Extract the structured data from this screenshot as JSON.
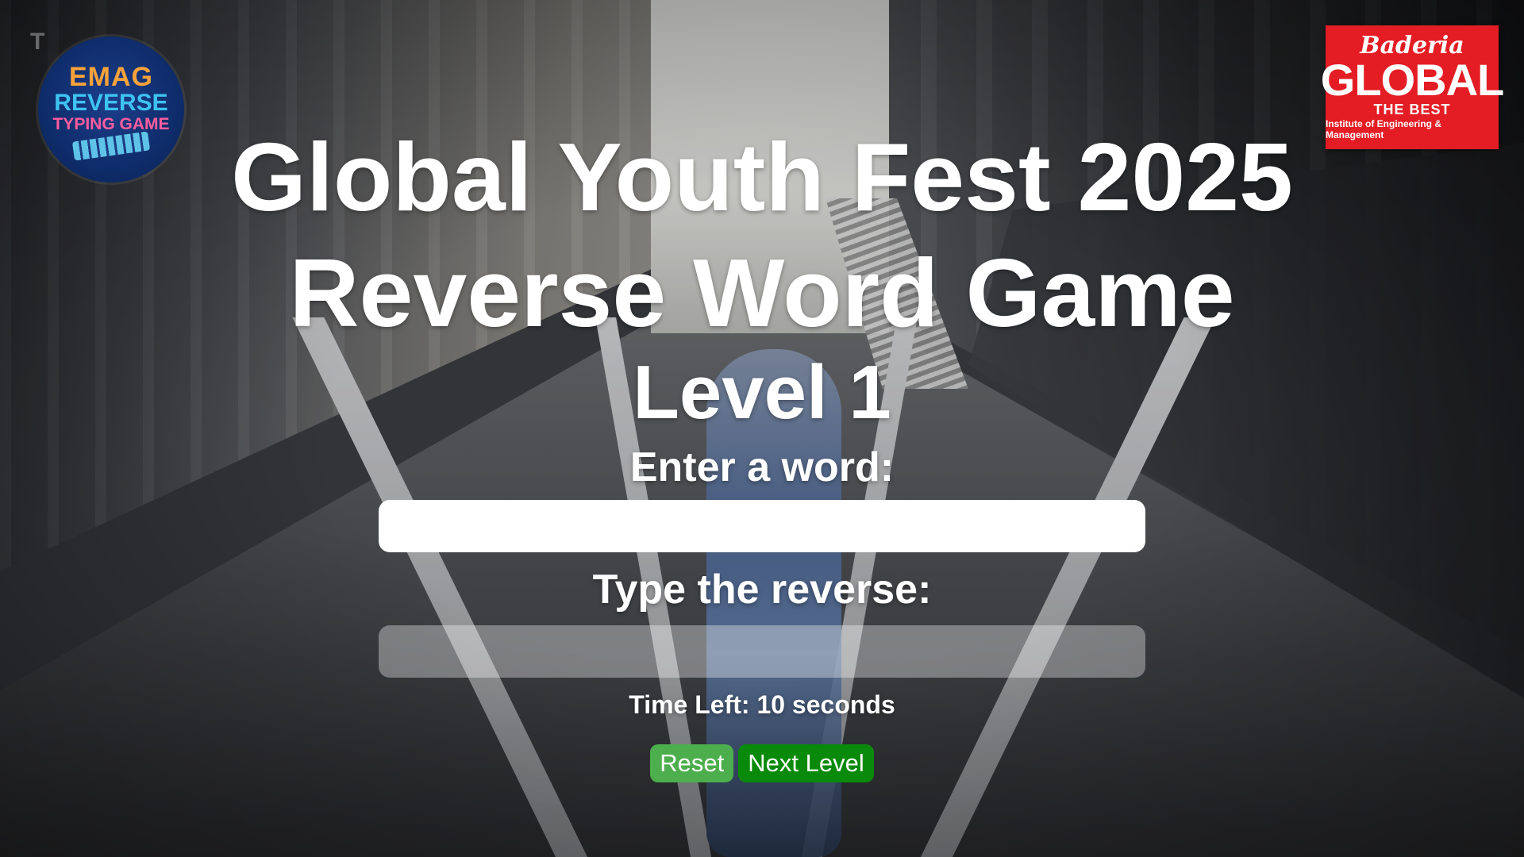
{
  "header": {
    "title_line1": "Global Youth Fest 2025",
    "title_line2": "Reverse Word Game",
    "level": "Level 1"
  },
  "logos": {
    "emag": {
      "line1": "EMAG",
      "line2": "REVERSE",
      "line3": "TYPING GAME"
    },
    "baderia": {
      "line1": "Baderia",
      "line2": "GLOBAL",
      "line3": "THE BEST",
      "line4": "Institute of Engineering & Management"
    }
  },
  "form": {
    "word_label": "Enter a word:",
    "word_value": "",
    "reverse_label": "Type the reverse:",
    "reverse_value": ""
  },
  "status": {
    "timer_text": "Time Left: 10 seconds"
  },
  "buttons": {
    "reset": "Reset",
    "next_level": "Next Level"
  },
  "colors": {
    "reset_button": "#4cae4c",
    "next_button": "#0a8a0a",
    "baderia_red": "#e41d24"
  }
}
